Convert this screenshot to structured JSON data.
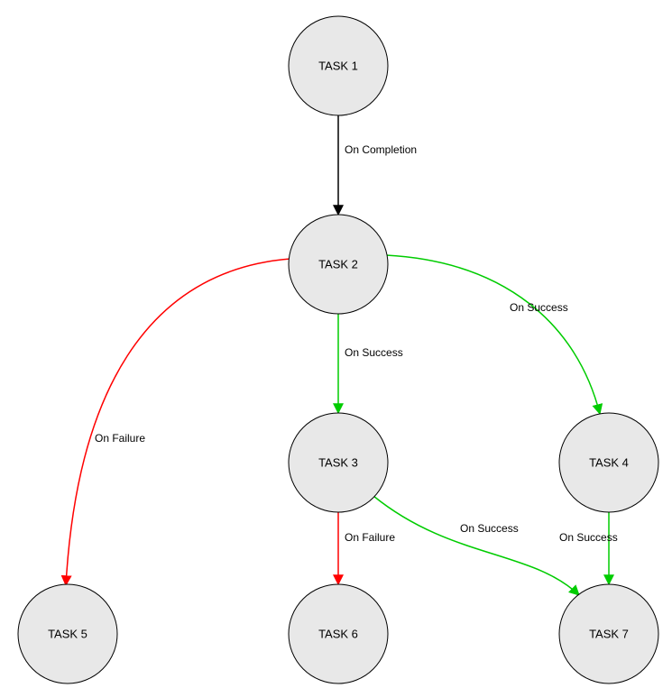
{
  "colors": {
    "completion": "#000000",
    "success": "#00cc00",
    "failure": "#ff0000"
  },
  "nodes": {
    "task1": {
      "label": "TASK 1"
    },
    "task2": {
      "label": "TASK 2"
    },
    "task3": {
      "label": "TASK 3"
    },
    "task4": {
      "label": "TASK 4"
    },
    "task5": {
      "label": "TASK 5"
    },
    "task6": {
      "label": "TASK 6"
    },
    "task7": {
      "label": "TASK 7"
    }
  },
  "edges": {
    "t1_t2": {
      "label": "On Completion",
      "type": "completion",
      "from": "task1",
      "to": "task2"
    },
    "t2_t3": {
      "label": "On Success",
      "type": "success",
      "from": "task2",
      "to": "task3"
    },
    "t2_t4": {
      "label": "On Success",
      "type": "success",
      "from": "task2",
      "to": "task4"
    },
    "t2_t5": {
      "label": "On Failure",
      "type": "failure",
      "from": "task2",
      "to": "task5"
    },
    "t3_t6": {
      "label": "On Failure",
      "type": "failure",
      "from": "task3",
      "to": "task6"
    },
    "t3_t7": {
      "label": "On Success",
      "type": "success",
      "from": "task3",
      "to": "task7"
    },
    "t4_t7": {
      "label": "On Success",
      "type": "success",
      "from": "task4",
      "to": "task7"
    }
  }
}
